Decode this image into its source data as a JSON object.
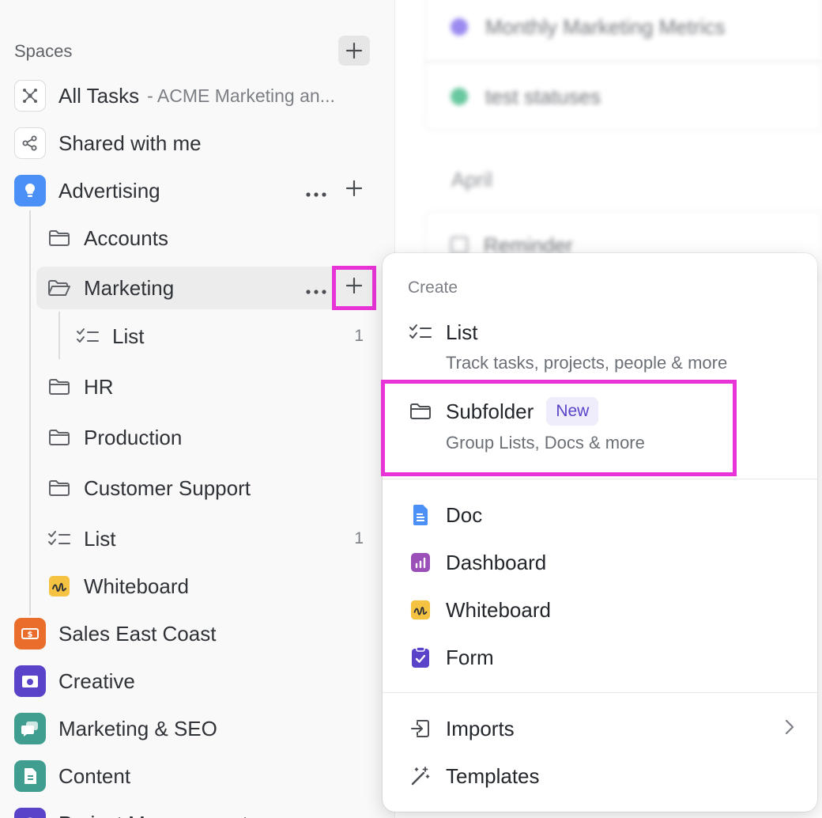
{
  "sidebar": {
    "spaces_header": "Spaces",
    "all_tasks": {
      "label": "All Tasks",
      "sub": "- ACME Marketing an..."
    },
    "shared": {
      "label": "Shared with me"
    },
    "advertising": {
      "label": "Advertising",
      "color": "#4a90f7"
    },
    "folders": [
      {
        "label": "Accounts"
      },
      {
        "label": "Marketing"
      }
    ],
    "marketing_list": {
      "label": "List",
      "count": "1"
    },
    "folders2": [
      {
        "label": "HR"
      },
      {
        "label": "Production"
      },
      {
        "label": "Customer Support"
      }
    ],
    "ad_list": {
      "label": "List",
      "count": "1"
    },
    "ad_whiteboard": {
      "label": "Whiteboard"
    },
    "spaces": [
      {
        "label": "Sales East Coast",
        "color": "#ea6d2c"
      },
      {
        "label": "Creative",
        "color": "#5b43c9"
      },
      {
        "label": "Marketing & SEO",
        "color": "#3f9e8f"
      },
      {
        "label": "Content",
        "color": "#3f9e8f"
      },
      {
        "label": "Project Management",
        "color": "#5b43c9"
      }
    ]
  },
  "background": {
    "rows": [
      {
        "label": "Monthly Marketing Metrics"
      },
      {
        "label": "test statuses"
      }
    ],
    "group": "April",
    "reminder": "Reminder"
  },
  "menu": {
    "section": "Create",
    "list": {
      "label": "List",
      "desc": "Track tasks, projects, people & more"
    },
    "subfolder": {
      "label": "Subfolder",
      "badge": "New",
      "desc": "Group Lists, Docs & more"
    },
    "doc": {
      "label": "Doc",
      "color": "#4a90f7"
    },
    "dashboard": {
      "label": "Dashboard",
      "color": "#9b4fb8"
    },
    "whiteboard": {
      "label": "Whiteboard",
      "color": "#f5c242"
    },
    "form": {
      "label": "Form",
      "color": "#5b43c9"
    },
    "imports": {
      "label": "Imports"
    },
    "templates": {
      "label": "Templates"
    }
  },
  "colors": {
    "highlight": "#e834d6"
  }
}
